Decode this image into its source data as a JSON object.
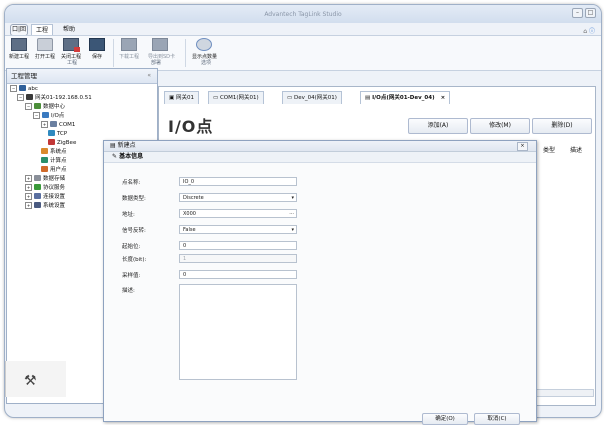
{
  "window": {
    "title": "Advantech TagLink Studio"
  },
  "qat": {
    "label": "口|回"
  },
  "menu": {
    "tabs": [
      "工程",
      "帮助"
    ]
  },
  "ribbon": {
    "buttons": [
      "新建工程",
      "打开工程",
      "关闭工程",
      "保存",
      "下载工程",
      "导出到SD卡",
      "显示点数量"
    ],
    "groups": [
      "工程",
      "部署",
      "选项"
    ]
  },
  "left_panel": {
    "title": "工程管理",
    "collapse": "«",
    "tree": [
      "abc",
      "网关01-192.168.0.51",
      "数据中心",
      "I/O点",
      "COM1",
      "TCP",
      "ZigBee",
      "系统点",
      "计算点",
      "用户点",
      "数据存储",
      "协议服务",
      "连接设置",
      "系统设置"
    ]
  },
  "doc_tabs": [
    "网关01",
    "COM1(网关01)",
    "Dev_04(网关01)",
    "I/O点(网关01-Dev_04)"
  ],
  "doc_tab_close": "×",
  "page": {
    "title": "I/O点"
  },
  "actions": {
    "add": "添加(A)",
    "modify": "修改(M)",
    "delete": "删除(D)"
  },
  "columns": {
    "type": "类型",
    "desc": "描述"
  },
  "dialog": {
    "title": "新建点",
    "section": "基本信息",
    "close": "×",
    "fields": {
      "name": {
        "label": "点名称:",
        "value": "IO_0"
      },
      "data_type": {
        "label": "数据类型:",
        "value": "Discrete"
      },
      "address": {
        "label": "地址:",
        "value": "X000"
      },
      "signal_reverse": {
        "label": "信号反转:",
        "value": "False"
      },
      "start_bit": {
        "label": "起始位:",
        "value": "0"
      },
      "length_bit": {
        "label": "长度(bit):",
        "value": "1"
      },
      "sample_interval": {
        "label": "采样值:",
        "value": "0"
      },
      "description": {
        "label": "描述:",
        "value": ""
      }
    },
    "ok": "确定(O)",
    "cancel": "取消(C)"
  }
}
